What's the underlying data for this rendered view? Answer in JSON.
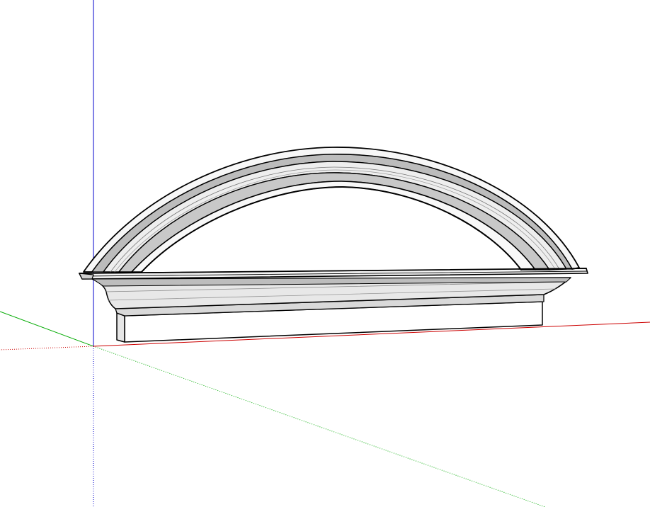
{
  "viewport": {
    "background": "#ffffff",
    "model_name": "arched-pediment-molding"
  },
  "axes": {
    "red_axis_color": "#cc0000",
    "green_axis_color": "#00aa00",
    "blue_axis_color": "#0000cc"
  },
  "model": {
    "edge_color": "#000000",
    "face_light": "#f2f2f2",
    "face_mid": "#d4d4d4",
    "face_dark": "#a8a8a8",
    "face_white": "#ffffff"
  }
}
